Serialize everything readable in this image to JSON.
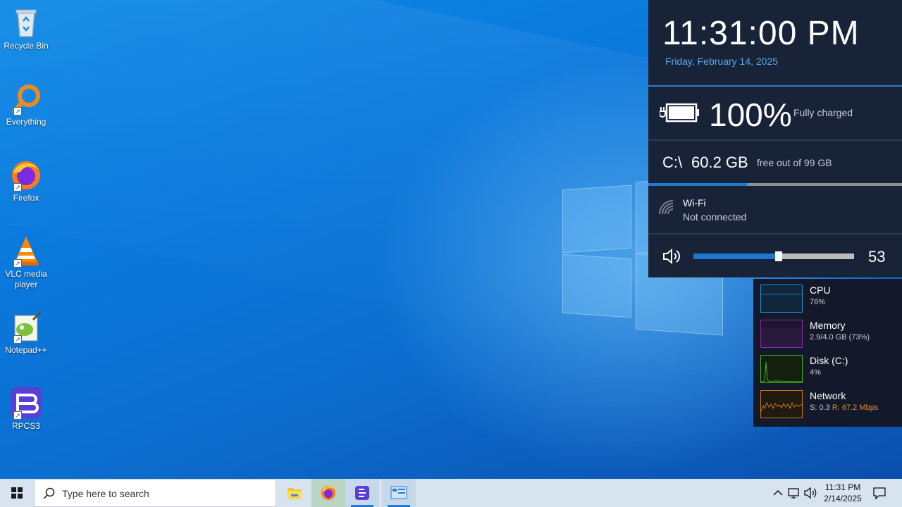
{
  "desktop": {
    "icons": [
      {
        "label": "Recycle Bin",
        "icon": "recycle-bin-icon"
      },
      {
        "label": "Everything",
        "icon": "everything-search-icon"
      },
      {
        "label": "Firefox",
        "icon": "firefox-icon"
      },
      {
        "label": "VLC media player",
        "icon": "vlc-icon"
      },
      {
        "label": "Notepad++",
        "icon": "notepadpp-icon"
      },
      {
        "label": "RPCS3",
        "icon": "rpcs3-icon"
      }
    ]
  },
  "info_panel": {
    "time": "11:31:00 PM",
    "date": "Friday, February 14, 2025",
    "battery": {
      "percent": "100%",
      "status": "Fully charged",
      "level": 1.0
    },
    "disk": {
      "drive": "C:\\",
      "free": "60.2 GB",
      "total": "free out of 99 GB",
      "used_fraction": 0.39
    },
    "wifi": {
      "name": "Wi-Fi",
      "status": "Not connected"
    },
    "volume": {
      "value": "53",
      "level": 0.53
    }
  },
  "perf": {
    "cpu": {
      "name": "CPU",
      "value": "76%",
      "color": "#1e90d6"
    },
    "memory": {
      "name": "Memory",
      "value": "2.9/4.0 GB (73%)",
      "color": "#8a2aa8"
    },
    "disk": {
      "name": "Disk (C:)",
      "value": "4%",
      "color": "#4caf1a"
    },
    "network": {
      "name": "Network",
      "value_send": "S: 0.3",
      "value_recv": "R: 67.2 Mbps",
      "color": "#c87a1a",
      "recv_color": "#e08a2a"
    }
  },
  "taskbar": {
    "search_placeholder": "Type here to search",
    "apps": [
      "file-explorer-icon",
      "firefox-icon",
      "rpcs3-icon",
      "control-panel-icon"
    ],
    "clock_time": "11:31 PM",
    "clock_date": "2/14/2025"
  }
}
